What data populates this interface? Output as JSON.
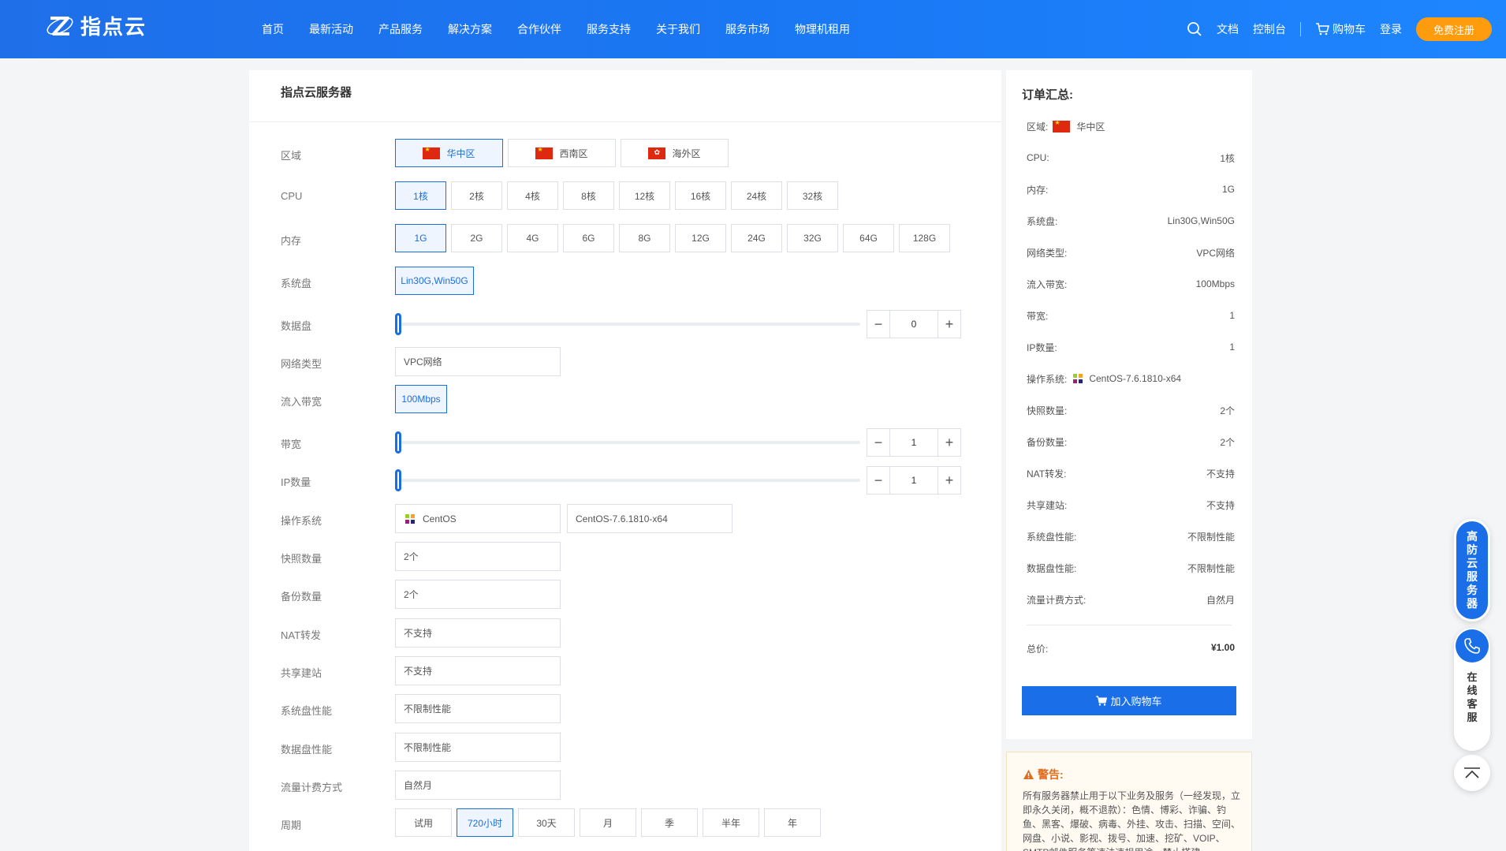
{
  "header": {
    "logo_text": "指点云",
    "nav": [
      "首页",
      "最新活动",
      "产品服务",
      "解决方案",
      "合作伙伴",
      "服务支持",
      "关于我们",
      "服务市场",
      "物理机租用"
    ],
    "docs": "文档",
    "console": "控制台",
    "cart": "购物车",
    "login": "登录",
    "register": "免费注册"
  },
  "main": {
    "title": "指点云服务器",
    "labels": {
      "region": "区域",
      "cpu": "CPU",
      "memory": "内存",
      "system_disk": "系统盘",
      "data_disk": "数据盘",
      "network_type": "网络类型",
      "inbound_bandwidth": "流入带宽",
      "bandwidth": "带宽",
      "ip_count": "IP数量",
      "os": "操作系统",
      "snapshot_count": "快照数量",
      "backup_count": "备份数量",
      "nat": "NAT转发",
      "shared_site": "共享建站",
      "sysdisk_perf": "系统盘性能",
      "datadisk_perf": "数据盘性能",
      "traffic_billing": "流量计费方式",
      "period": "周期"
    },
    "regions": [
      "华中区",
      "西南区",
      "海外区"
    ],
    "cpu_options": [
      "1核",
      "2核",
      "4核",
      "8核",
      "12核",
      "16核",
      "24核",
      "32核"
    ],
    "memory_options": [
      "1G",
      "2G",
      "4G",
      "6G",
      "8G",
      "12G",
      "24G",
      "32G",
      "64G",
      "128G"
    ],
    "system_disk": "Lin30G,Win50G",
    "data_disk_value": "0",
    "network_type": "VPC网络",
    "inbound_bandwidth": "100Mbps",
    "bandwidth_value": "1",
    "ip_value": "1",
    "os_name": "CentOS",
    "os_version": "CentOS-7.6.1810-x64",
    "snapshot_count": "2个",
    "backup_count": "2个",
    "nat": "不支持",
    "shared_site": "不支持",
    "sysdisk_perf": "不限制性能",
    "datadisk_perf": "不限制性能",
    "traffic_billing": "自然月",
    "periods": [
      "试用",
      "720小时",
      "30天",
      "月",
      "季",
      "半年",
      "年"
    ]
  },
  "summary": {
    "title": "订单汇总:",
    "region_label": "区域:",
    "region_value": "华中区",
    "rows": [
      {
        "k": "CPU:",
        "v": "1核"
      },
      {
        "k": "内存:",
        "v": "1G"
      },
      {
        "k": "系统盘:",
        "v": "Lin30G,Win50G"
      },
      {
        "k": "网络类型:",
        "v": "VPC网络"
      },
      {
        "k": "流入带宽:",
        "v": "100Mbps"
      },
      {
        "k": "带宽:",
        "v": "1"
      },
      {
        "k": "IP数量:",
        "v": "1"
      }
    ],
    "os_label": "操作系统:",
    "os_value": "CentOS-7.6.1810-x64",
    "rows2": [
      {
        "k": "快照数量:",
        "v": "2个"
      },
      {
        "k": "备份数量:",
        "v": "2个"
      },
      {
        "k": "NAT转发:",
        "v": "不支持"
      },
      {
        "k": "共享建站:",
        "v": "不支持"
      },
      {
        "k": "系统盘性能:",
        "v": "不限制性能"
      },
      {
        "k": "数据盘性能:",
        "v": "不限制性能"
      },
      {
        "k": "流量计费方式:",
        "v": "自然月"
      }
    ],
    "total_label": "总价:",
    "total_value": "¥1.00",
    "add_cart": "加入购物车"
  },
  "warning": {
    "title": "警告:",
    "body": "所有服务器禁止用于以下业务及服务（一经发现，立即永久关闭，概不退款）：色情、博彩、诈骗、钓鱼、黑客、爆破、病毒、外挂、攻击、扫描、空间、网盘、小说、影视、拨号、加速、挖矿、VOIP、SMTP邮件服务等违法违规用途，禁止搭建"
  },
  "floating": {
    "ddos_server": "高防云服务器",
    "online_service": "在线客服"
  },
  "colors": {
    "primary": "#1a6fe8",
    "header_start": "#1f6fe9",
    "header_end": "#1e86ff",
    "register": "#ff9c0e",
    "warning": "#e06b1d"
  }
}
